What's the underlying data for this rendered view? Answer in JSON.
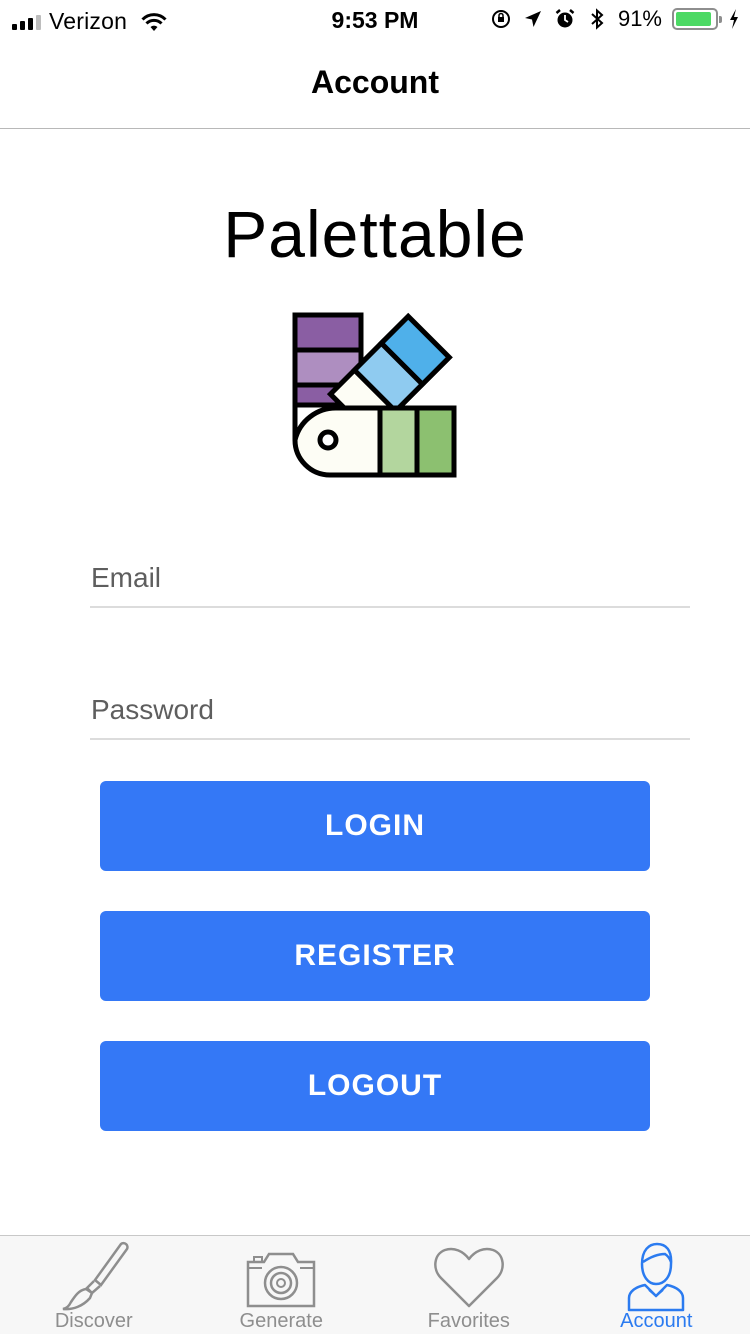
{
  "status_bar": {
    "carrier": "Verizon",
    "time": "9:53 PM",
    "battery_percent": "91%",
    "battery_level": 0.91
  },
  "nav": {
    "title": "Account"
  },
  "app": {
    "name": "Palettable"
  },
  "form": {
    "email_placeholder": "Email",
    "email_value": "",
    "password_placeholder": "Password",
    "password_value": ""
  },
  "buttons": {
    "login": "LOGIN",
    "register": "REGISTER",
    "logout": "LOGOUT"
  },
  "tabs": [
    {
      "label": "Discover",
      "icon": "paintbrush-icon",
      "active": false
    },
    {
      "label": "Generate",
      "icon": "camera-icon",
      "active": false
    },
    {
      "label": "Favorites",
      "icon": "heart-icon",
      "active": false
    },
    {
      "label": "Account",
      "icon": "user-icon",
      "active": true
    }
  ],
  "colors": {
    "accent": "#3478f6",
    "tab_active": "#2b7bf0",
    "tab_inactive": "#8e8e8e",
    "swatch_purple_dark": "#8a5ea3",
    "swatch_purple_light": "#ae8ec0",
    "swatch_blue_dark": "#4fb0ea",
    "swatch_blue_light": "#8fcbf0",
    "swatch_green_light": "#b3d69e",
    "swatch_green_dark": "#8cc070",
    "battery_fill": "#4cd964"
  }
}
